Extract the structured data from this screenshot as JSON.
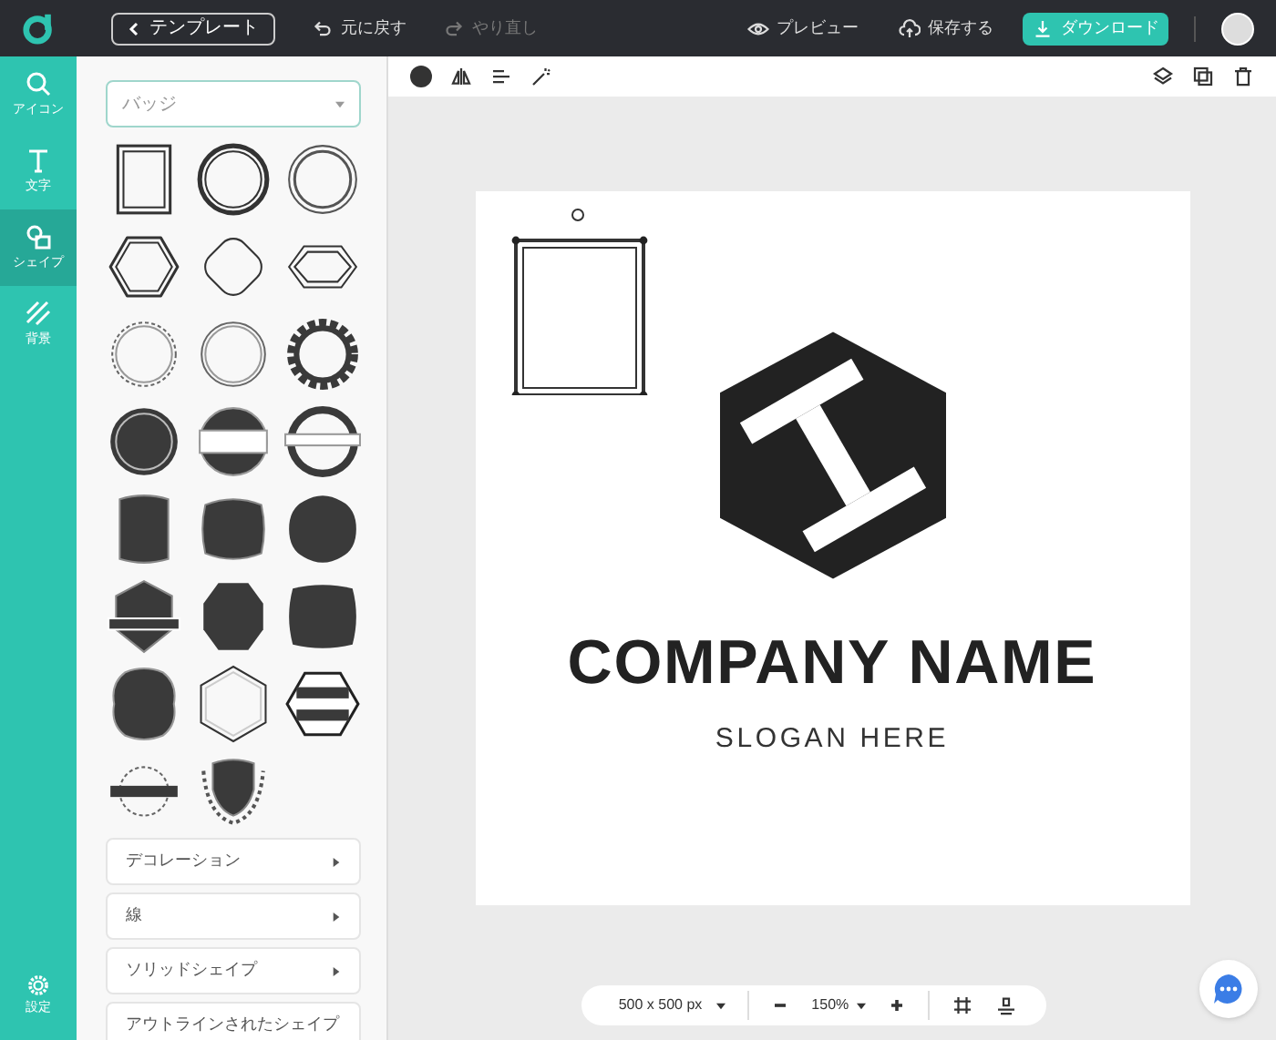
{
  "topbar": {
    "template_button": "テンプレート",
    "undo": {
      "label": "元に戻す",
      "disabled": false
    },
    "redo": {
      "label": "やり直し",
      "disabled": true
    },
    "preview": "プレビュー",
    "save": "保存する",
    "download": "ダウンロード"
  },
  "sidebar": {
    "items": [
      {
        "label": "アイコン",
        "selected": false
      },
      {
        "label": "文字",
        "selected": false
      },
      {
        "label": "シェイプ",
        "selected": true
      },
      {
        "label": "背景",
        "selected": false
      }
    ],
    "settings": "設定"
  },
  "panel": {
    "dropdown": "バッジ",
    "categories": [
      "デコレーション",
      "線",
      "ソリッドシェイプ",
      "アウトラインされたシェイプ"
    ]
  },
  "canvas": {
    "company_name": "COMPANY NAME",
    "slogan": "SLOGAN HERE"
  },
  "zoom_bar": {
    "size": "500 x 500 px",
    "zoom": "150%"
  }
}
